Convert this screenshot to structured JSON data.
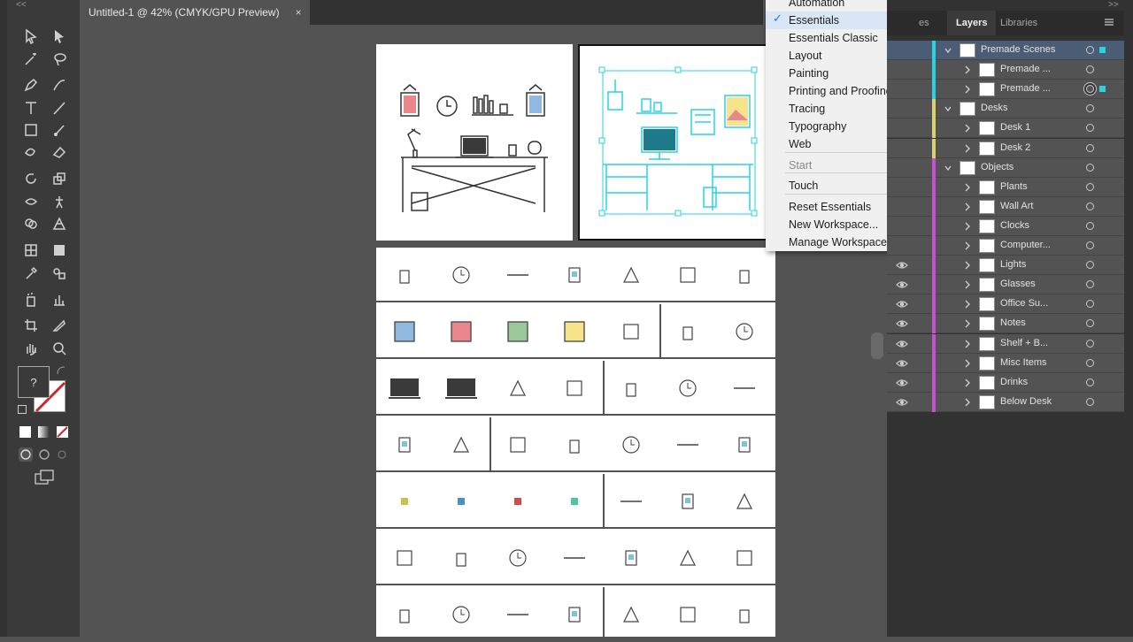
{
  "app": {
    "collapse_left": "<<",
    "collapse_right": ">>"
  },
  "document_tab": {
    "title": "Untitled-1 @ 42% (CMYK/GPU Preview)",
    "close": "×"
  },
  "workspace_menu": {
    "items": [
      {
        "label": "Automation",
        "state": "normal"
      },
      {
        "label": "Essentials",
        "state": "checked"
      },
      {
        "label": "Essentials Classic",
        "state": "normal"
      },
      {
        "label": "Layout",
        "state": "normal"
      },
      {
        "label": "Painting",
        "state": "normal"
      },
      {
        "label": "Printing and Proofing",
        "state": "normal"
      },
      {
        "label": "Tracing",
        "state": "normal"
      },
      {
        "label": "Typography",
        "state": "normal"
      },
      {
        "label": "Web",
        "state": "normal"
      },
      {
        "label": "Start",
        "state": "disabled"
      },
      {
        "label": "Touch",
        "state": "normal"
      },
      {
        "label": "Reset Essentials",
        "state": "normal"
      },
      {
        "label": "New Workspace...",
        "state": "normal"
      },
      {
        "label": "Manage Workspaces...",
        "state": "normal"
      }
    ],
    "check_glyph": "✓"
  },
  "panel": {
    "tabs": [
      "es",
      "Layers",
      "Libraries"
    ],
    "active_tab": "Layers"
  },
  "layers": [
    {
      "name": "Premade Scenes",
      "level": 0,
      "expanded": true,
      "color": "#2ad2e0",
      "eye": false,
      "selected": true,
      "has_selection": true
    },
    {
      "name": "Premade ...",
      "level": 1,
      "expanded": false,
      "color": "#2ad2e0",
      "eye": false
    },
    {
      "name": "Premade ...",
      "level": 1,
      "expanded": false,
      "color": "#2ad2e0",
      "eye": false,
      "target_filled": true,
      "has_selection": true
    },
    {
      "name": "Desks",
      "level": 0,
      "expanded": true,
      "color": "#d8d26a",
      "eye": false
    },
    {
      "name": "Desk 1",
      "level": 1,
      "expanded": false,
      "color": "#d8d26a",
      "eye": false
    },
    {
      "name": "Desk 2",
      "level": 1,
      "expanded": false,
      "color": "#d8d26a",
      "eye": false
    },
    {
      "name": "Objects",
      "level": 0,
      "expanded": true,
      "color": "#c64fd2",
      "eye": false
    },
    {
      "name": "Plants",
      "level": 1,
      "expanded": false,
      "color": "#c64fd2",
      "eye": false
    },
    {
      "name": "Wall Art",
      "level": 1,
      "expanded": false,
      "color": "#c64fd2",
      "eye": false
    },
    {
      "name": "Clocks",
      "level": 1,
      "expanded": false,
      "color": "#c64fd2",
      "eye": false
    },
    {
      "name": "Computer...",
      "level": 1,
      "expanded": false,
      "color": "#c64fd2",
      "eye": false
    },
    {
      "name": "Lights",
      "level": 1,
      "expanded": false,
      "color": "#c64fd2",
      "eye": true
    },
    {
      "name": "Glasses",
      "level": 1,
      "expanded": false,
      "color": "#c64fd2",
      "eye": true
    },
    {
      "name": "Office Su...",
      "level": 1,
      "expanded": false,
      "color": "#c64fd2",
      "eye": true
    },
    {
      "name": "Notes",
      "level": 1,
      "expanded": false,
      "color": "#c64fd2",
      "eye": true
    },
    {
      "name": "Shelf + B...",
      "level": 1,
      "expanded": false,
      "color": "#c64fd2",
      "eye": true
    },
    {
      "name": "Misc Items",
      "level": 1,
      "expanded": false,
      "color": "#c64fd2",
      "eye": true
    },
    {
      "name": "Drinks",
      "level": 1,
      "expanded": false,
      "color": "#c64fd2",
      "eye": true
    },
    {
      "name": "Below Desk",
      "level": 1,
      "expanded": false,
      "color": "#c64fd2",
      "eye": true
    }
  ],
  "colors": {
    "selection": "#2ad2e0",
    "menu_highlight": "#d9e6f5",
    "check": "#2a73d6"
  },
  "fill_stroke": {
    "unknown_glyph": "?"
  }
}
